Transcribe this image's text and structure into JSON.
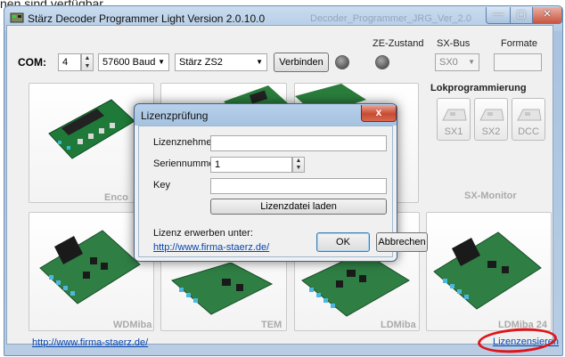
{
  "caption": "nen sind verfügbar.",
  "window": {
    "title": "Stärz Decoder Programmer Light Version 2.0.10.0",
    "ghost_title": "Decoder_Programmer_JRG_Ver_2.0",
    "caption_buttons": {
      "minimize": "—",
      "maximize": "▢",
      "close": "✕"
    }
  },
  "toolbar": {
    "com_label": "COM:",
    "com_port": "4",
    "baud": "57600 Baud",
    "device": "Stärz ZS2",
    "connect_label": "Verbinden",
    "ze_label": "ZE-Zustand",
    "sxbus_label": "SX-Bus",
    "sxbus_value": "SX0",
    "formate_label": "Formate",
    "formate_value": ""
  },
  "tiles": [
    {
      "label": "Enco"
    },
    {
      "label": ""
    },
    {
      "label": "SX-Monitor"
    },
    {
      "label": "WDMiba"
    },
    {
      "label": "TEM"
    },
    {
      "label": "LDMiba"
    },
    {
      "label": "LDMiba 24"
    }
  ],
  "loco": {
    "title": "Lokprogrammierung",
    "buttons": [
      {
        "label": "SX1"
      },
      {
        "label": "SX2"
      },
      {
        "label": "DCC"
      }
    ]
  },
  "footer": {
    "website": "http://www.firma-staerz.de/",
    "license_link": "Lizenzensieren"
  },
  "dialog": {
    "title": "Lizenzprüfung",
    "close_glyph": "x",
    "licensee_label": "Lizenznehmer",
    "licensee_value": "",
    "serial_label": "Seriennummer",
    "serial_value": "1",
    "key_label": "Key",
    "key_value": "",
    "load_button": "Lizenzdatei laden",
    "acquire_text": "Lizenz erwerben unter:",
    "acquire_link": "http://www.firma-staerz.de/",
    "ok_button": "OK",
    "cancel_button": "Abbrechen"
  },
  "colors": {
    "annotation_ring": "#e0141b",
    "link": "#0645ad",
    "close_red": "#c84a31"
  }
}
